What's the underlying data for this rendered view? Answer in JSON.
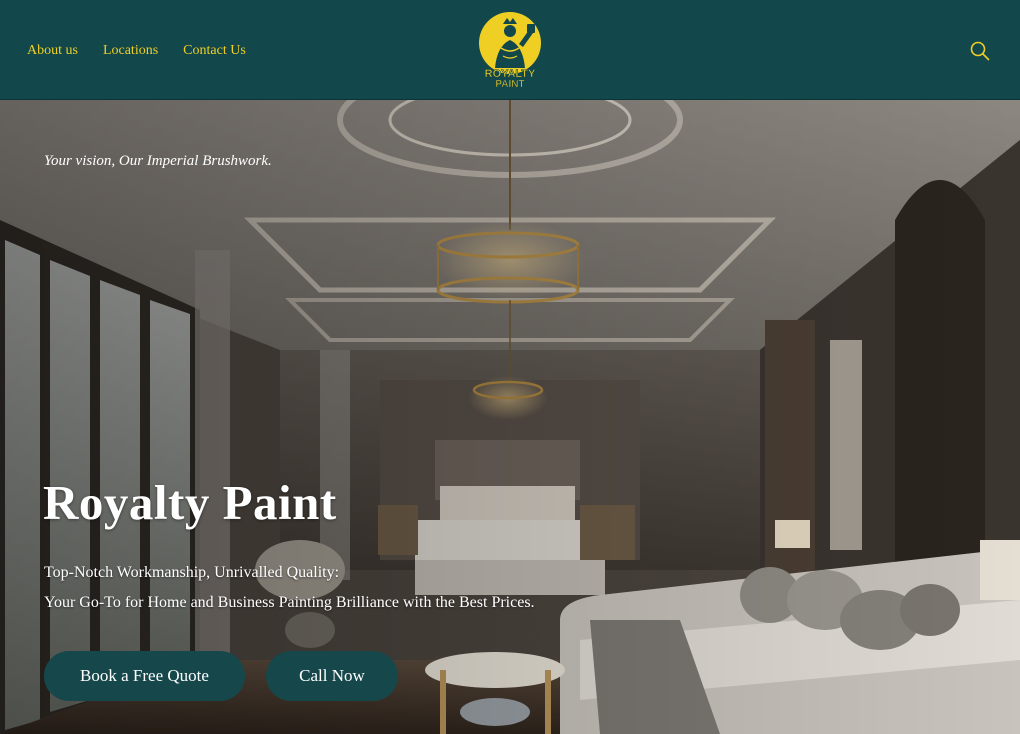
{
  "header": {
    "nav": [
      {
        "label": "About us"
      },
      {
        "label": "Locations"
      },
      {
        "label": "Contact Us"
      }
    ],
    "logo": {
      "line1": "ROYALTY",
      "line2": "PAINT"
    },
    "search_icon": "search-icon"
  },
  "hero": {
    "tagline": "Your vision, Our Imperial Brushwork.",
    "title": "Royalty Paint",
    "subtitle_line1": "Top-Notch Workmanship, Unrivalled Quality:",
    "subtitle_line2": "Your Go-To for Home and Business Painting Brilliance with the Best Prices.",
    "buttons": {
      "quote": "Book a Free Quote",
      "call": "Call Now"
    }
  },
  "colors": {
    "header_bg": "#12484b",
    "accent_yellow": "#f0cf25",
    "button_bg": "#16484b"
  }
}
